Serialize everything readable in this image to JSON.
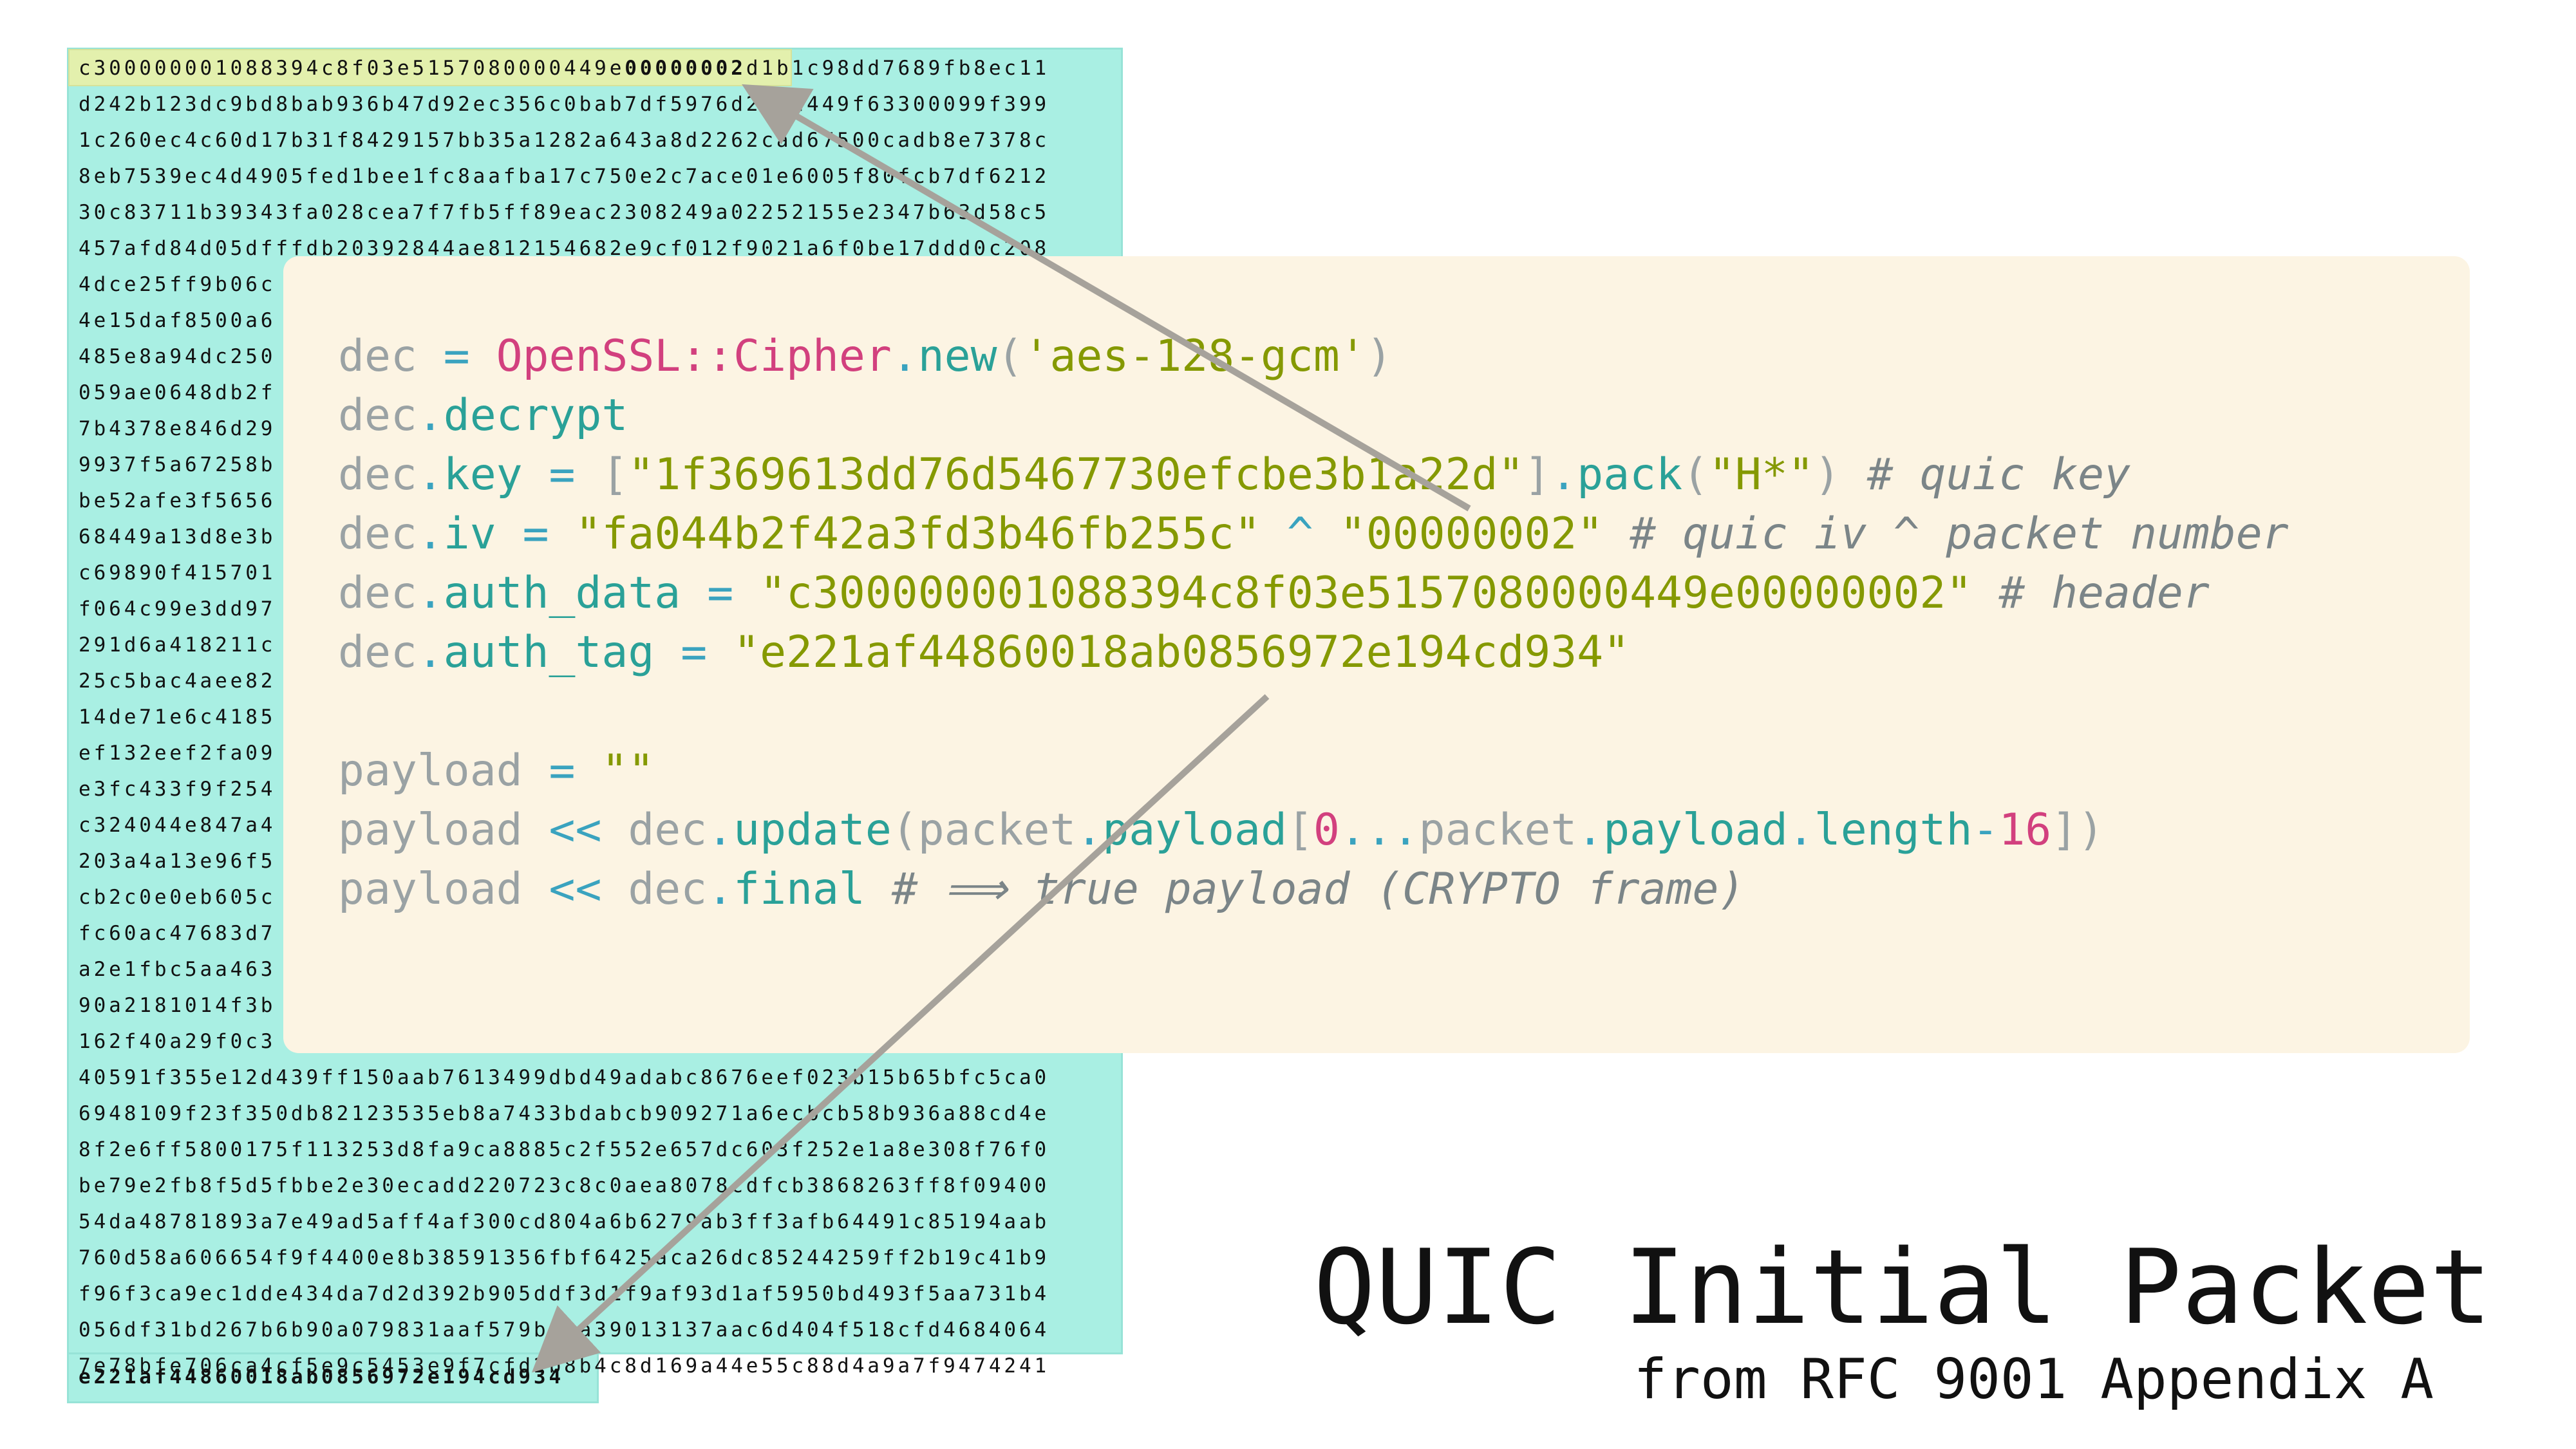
{
  "hex": {
    "line1_a": "c300000001088394c8f03e5157080000449e",
    "line1_b": "00000002",
    "line1_c": "d1b1c98dd7689fb8ec11",
    "lines": [
      "d242b123dc9bd8bab936b47d92ec356c0bab7df5976d27cd449f63300099f399",
      "1c260ec4c60d17b31f8429157bb35a1282a643a8d2262cad67500cadb8e7378c",
      "8eb7539ec4d4905fed1bee1fc8aafba17c750e2c7ace01e6005f80fcb7df6212",
      "30c83711b39343fa028cea7f7fb5ff89eac2308249a02252155e2347b63d58c5",
      "457afd84d05dfffdb20392844ae812154682e9cf012f9021a6f0be17ddd0c208",
      "4dce25ff9b06c",
      "4e15daf8500a6",
      "485e8a94dc250",
      "059ae0648db2f",
      "7b4378e846d29",
      "9937f5a67258b",
      "be52afe3f5656",
      "68449a13d8e3b",
      "c69890f415701",
      "f064c99e3dd97",
      "291d6a418211c",
      "25c5bac4aee82",
      "14de71e6c4185",
      "ef132eef2fa09",
      "e3fc433f9f254",
      "c324044e847a4",
      "203a4a13e96f5",
      "cb2c0e0eb605c",
      "fc60ac47683d7",
      "a2e1fbc5aa463",
      "90a2181014f3b",
      "162f40a29f0c3",
      "40591f355e12d439ff150aab7613499dbd49adabc8676eef023b15b65bfc5ca0",
      "6948109f23f350db82123535eb8a7433bdabcb909271a6ecbcb58b936a88cd4e",
      "8f2e6ff5800175f113253d8fa9ca8885c2f552e657dc603f252e1a8e308f76f0",
      "be79e2fb8f5d5fbbe2e30ecadd220723c8c0aea8078cdfcb3868263ff8f09400",
      "54da48781893a7e49ad5aff4af300cd804a6b6279ab3ff3afb64491c85194aab",
      "760d58a606654f9f4400e8b38591356fbf6425aca26dc85244259ff2b19c41b9",
      "f96f3ca9ec1dde434da7d2d392b905ddf3d1f9af93d1af5950bd493f5aa731b4",
      "056df31bd267b6b90a079831aaf579be0a39013137aac6d404f518cfd4684064",
      "7e78bfe706ca4cf5e9c5453e9f7cfd2b8b4c8d169a44e55c88d4a9a7f9474241"
    ],
    "tag_line": "e221af44860018ab0856972e194cd934"
  },
  "code": {
    "l1": {
      "a": "dec",
      "b": " = ",
      "c": "OpenSSL",
      "d": "::",
      "e": "Cipher",
      "f": ".",
      "g": "new",
      "h": "(",
      "i": "'aes-128-gcm'",
      "j": ")"
    },
    "l2": {
      "a": "dec",
      "b": ".",
      "c": "decrypt"
    },
    "l3": {
      "a": "dec",
      "b": ".",
      "c": "key",
      "d": " = ",
      "e": "[",
      "f": "\"1f369613dd76d5467730efcbe3b1a22d\"",
      "g": "]",
      "h": ".",
      "i": "pack",
      "j": "(",
      "k": "\"H*\"",
      "l": ")",
      "m": " # quic key"
    },
    "l4": {
      "a": "dec",
      "b": ".",
      "c": "iv",
      "d": " = ",
      "e": "\"fa044b2f42a3fd3b46fb255c\"",
      "f": " ^ ",
      "g": "\"00000002\"",
      "h": " # quic iv ^ packet number"
    },
    "l5": {
      "a": "dec",
      "b": ".",
      "c": "auth_data",
      "d": " = ",
      "e": "\"c300000001088394c8f03e5157080000449e00000002\"",
      "f": " # header"
    },
    "l6": {
      "a": "dec",
      "b": ".",
      "c": "auth_tag",
      "d": " = ",
      "e": "\"e221af44860018ab0856972e194cd934\""
    },
    "l8": {
      "a": "payload",
      "b": " = ",
      "c": "\"\""
    },
    "l9": {
      "a": "payload",
      "b": " << ",
      "c": "dec",
      "d": ".",
      "e": "update",
      "f": "(",
      "g": "packet",
      "h": ".",
      "i": "payload",
      "j": "[",
      "k": "0",
      "l": "...",
      "m": "packet",
      "n": ".",
      "o": "payload",
      "p": ".",
      "q": "length",
      "r": "-",
      "s": "16",
      "t": "])"
    },
    "l10": {
      "a": "payload",
      "b": " << ",
      "c": "dec",
      "d": ".",
      "e": "final",
      "f": " # ⟹ true payload (CRYPTO frame)"
    }
  },
  "title": "QUIC Initial Packet",
  "subtitle": "from RFC 9001 Appendix A",
  "colors": {
    "hex_bg": "#a9efe3",
    "header_highlight": "#e3f0ad",
    "code_card_bg": "#fcf4e3",
    "arrow": "#a6a29b",
    "string": "#859900",
    "constant": "#d2407e",
    "method": "#2aa198"
  }
}
